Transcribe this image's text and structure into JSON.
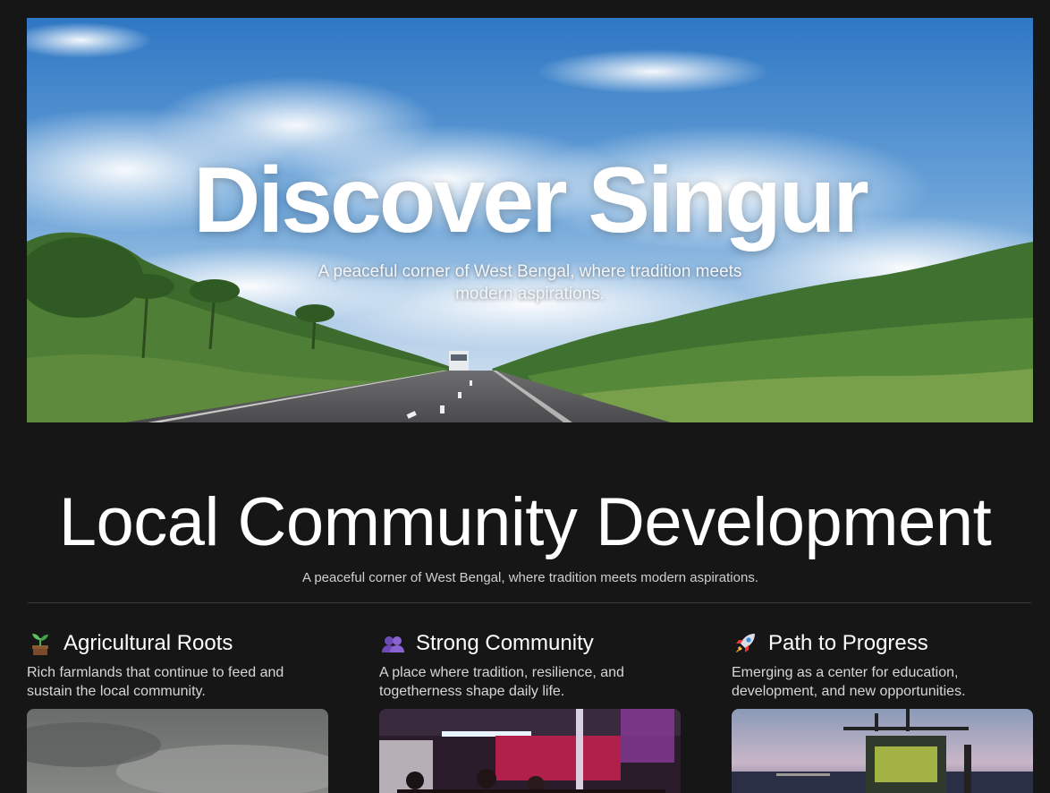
{
  "hero": {
    "title": "Discover Singur",
    "subtitle": "A peaceful corner of West Bengal, where tradition meets modern aspirations."
  },
  "community": {
    "title": "Local Community Development",
    "subtitle": "A peaceful corner of West Bengal, where tradition meets modern aspirations."
  },
  "cards": [
    {
      "icon": "seedling-icon",
      "title": "Agricultural Roots",
      "description": "Rich farmlands that continue to feed and sustain the local community."
    },
    {
      "icon": "people-icon",
      "title": "Strong Community",
      "description": "A place where tradition, resilience, and togetherness shape daily life."
    },
    {
      "icon": "rocket-icon",
      "title": "Path to Progress",
      "description": "Emerging as a center for education, development, and new opportunities."
    }
  ],
  "colors": {
    "background": "#161616",
    "text": "#ffffff",
    "muted_text": "#d6d6d6",
    "divider": "#3a3a3a"
  }
}
